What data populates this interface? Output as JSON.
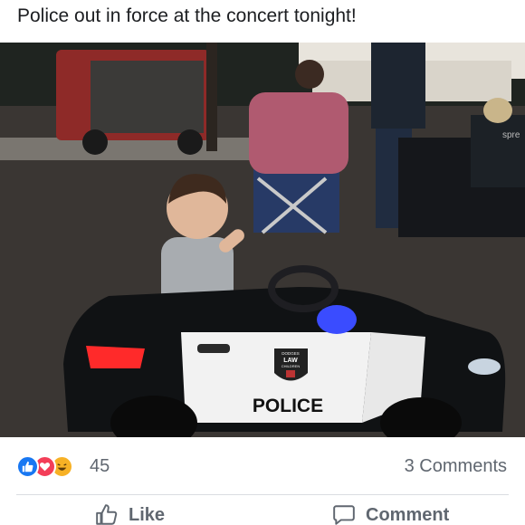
{
  "post": {
    "caption": "Police out in force at the concert tonight!"
  },
  "photo": {
    "car_text": "POLICE",
    "badge_top": "DODGES",
    "badge_mid": "LAW",
    "badge_low": "CHILDREN",
    "chair_text": "spre"
  },
  "reactions": {
    "types": [
      "like",
      "love",
      "haha"
    ],
    "count": "45",
    "comments_label": "3 Comments"
  },
  "actions": {
    "like_label": "Like",
    "comment_label": "Comment"
  },
  "colors": {
    "like_blue": "#1877f2",
    "love_red": "#f33e58",
    "haha_yellow": "#f7b125",
    "meta_gray": "#606770"
  }
}
